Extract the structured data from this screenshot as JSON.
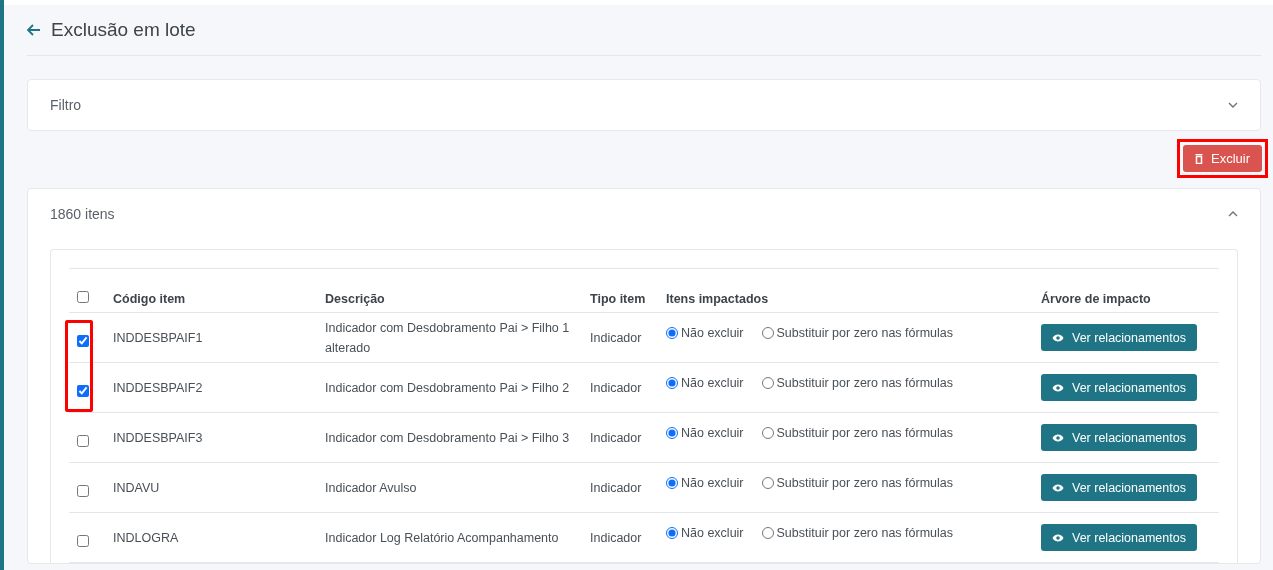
{
  "page": {
    "title": "Exclusão em lote"
  },
  "filter": {
    "title": "Filtro"
  },
  "delete_button": {
    "label": "Excluir",
    "highlighted": true
  },
  "items_panel": {
    "title": "1860 itens"
  },
  "table": {
    "select_all_checked": false,
    "columns": [
      "Código item",
      "Descrição",
      "Tipo item",
      "Itens impactados",
      "Árvore de impacto"
    ],
    "rows": [
      {
        "checked": true,
        "highlighted": true,
        "code": "INDDESBPAIF1",
        "description": "Indicador com Desdobramento Pai > Filho 1 alterado",
        "type": "Indicador",
        "options": [
          {
            "label": "Não excluir",
            "selected": true
          },
          {
            "label": "Substituir por zero nas fórmulas",
            "selected": false
          }
        ],
        "action": "Ver relacionamentos"
      },
      {
        "checked": true,
        "highlighted": true,
        "code": "INDDESBPAIF2",
        "description": "Indicador com Desdobramento Pai > Filho 2",
        "type": "Indicador",
        "options": [
          {
            "label": "Não excluir",
            "selected": true
          },
          {
            "label": "Substituir por zero nas fórmulas",
            "selected": false
          }
        ],
        "action": "Ver relacionamentos"
      },
      {
        "checked": false,
        "highlighted": false,
        "code": "INDDESBPAIF3",
        "description": "Indicador com Desdobramento Pai > Filho 3",
        "type": "Indicador",
        "options": [
          {
            "label": "Não excluir",
            "selected": true
          },
          {
            "label": "Substituir por zero nas fórmulas",
            "selected": false
          }
        ],
        "action": "Ver relacionamentos"
      },
      {
        "checked": false,
        "highlighted": false,
        "code": "INDAVU",
        "description": "Indicador Avulso",
        "type": "Indicador",
        "options": [
          {
            "label": "Não excluir",
            "selected": true
          },
          {
            "label": "Substituir por zero nas fórmulas",
            "selected": false
          }
        ],
        "action": "Ver relacionamentos"
      },
      {
        "checked": false,
        "highlighted": false,
        "code": "INDLOGRA",
        "description": "Indicador Log Relatório Acompanhamento",
        "type": "Indicador",
        "options": [
          {
            "label": "Não excluir",
            "selected": true
          },
          {
            "label": "Substituir por zero nas fórmulas",
            "selected": false
          }
        ],
        "action": "Ver relacionamentos"
      }
    ]
  }
}
